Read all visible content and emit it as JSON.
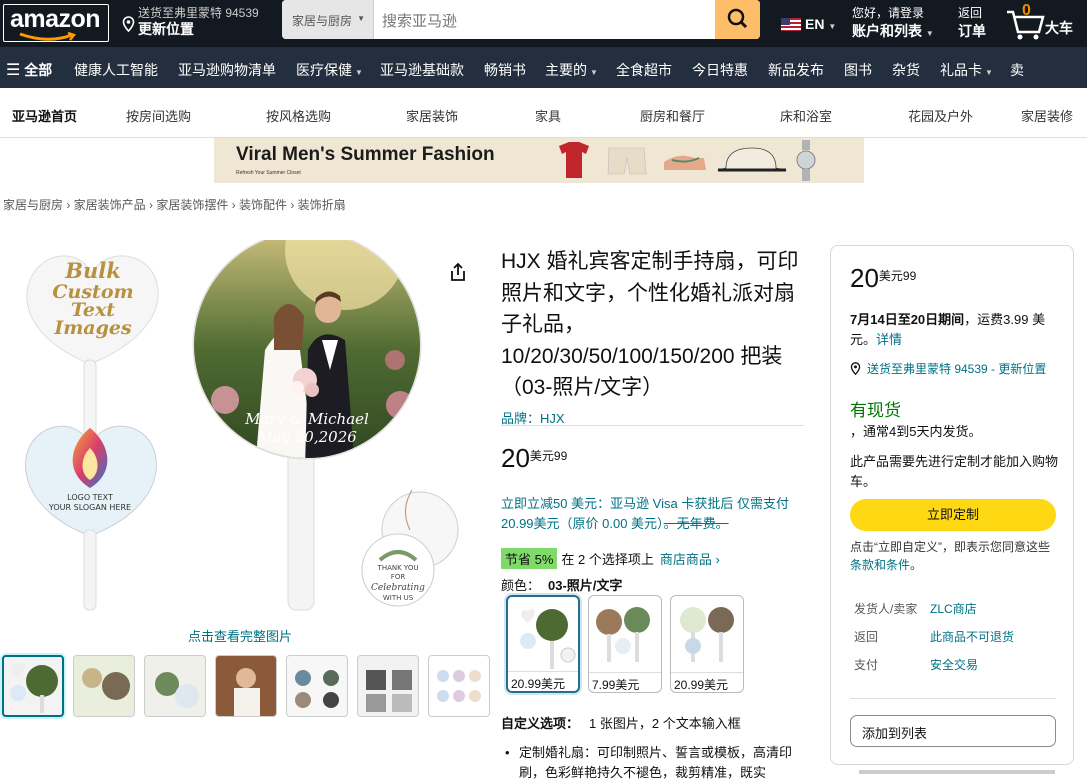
{
  "header": {
    "logo_text": "amazon",
    "deliver_line1": "送货至弗里蒙特 94539",
    "deliver_line2": "更新位置",
    "search_category": "家居与厨房",
    "search_placeholder": "搜索亚马逊",
    "language": "EN",
    "account_line1": "您好，请登录",
    "account_line2": "账户和列表",
    "orders_line1": "返回",
    "orders_line2": "订单",
    "cart_count": "0",
    "cart_label": "大车"
  },
  "nav": {
    "all": "全部",
    "items": [
      "健康人工智能",
      "亚马逊购物清单",
      "医疗保健",
      "亚马逊基础款",
      "畅销书",
      "主要的",
      "全食超市",
      "今日特惠",
      "新品发布",
      "图书",
      "杂货",
      "礼品卡",
      "卖"
    ]
  },
  "subnav": {
    "home": "亚马逊首页",
    "items": [
      "按房间选购",
      "按风格选购",
      "家居装饰",
      "家具",
      "厨房和餐厅",
      "床和浴室",
      "花园及户外",
      "家居装修"
    ]
  },
  "banner": {
    "title": "Viral Men's Summer Fashion",
    "subtitle": "Refresh Your Summer Closet"
  },
  "breadcrumb": "家居与厨房 › 家居装饰产品 › 家居装饰摆件 › 装饰配件 › 装饰折扇",
  "gallery": {
    "fan_text_1": "Bulk Custom Text Images",
    "fan_logo_text": "LOGO TEXT",
    "fan_slogan": "YOUR SLOGAN HERE",
    "names": "Mary & Michael",
    "date": "May 20,2026",
    "tag_text": "THANK YOU FOR Celebrating WITH US",
    "see_full": "点击查看完整图片"
  },
  "product": {
    "title": "HJX 婚礼宾客定制手持扇，可印照片和文字，个性化婚礼派对扇子礼品，10/20/30/50/100/150/200 把装（03-照片/文字）",
    "brand": "品牌：HJX",
    "price_whole": "20",
    "price_sup": "美元99",
    "promo": "立即立减50 美元：亚马逊 Visa 卡获批后 仅需支付 20.99美元（原价 0.00 美元）",
    "promo_strike": "。无年费。",
    "save_badge": "节省 5%",
    "save_text": "在 2 个选择项上",
    "save_link": "商店商品 ›",
    "color_label": "颜色：",
    "color_value": "03-照片/文字",
    "swatches": [
      {
        "price": "20.99美元"
      },
      {
        "price": "7.99美元"
      },
      {
        "price": "20.99美元"
      }
    ],
    "custom_label": "自定义选项：",
    "custom_value": "1 张图片，2 个文本输入框",
    "bullet_1": "定制婚礼扇：可印制照片、誓言或模板，高清印刷，色彩鲜艳持久不褪色，裁剪精准，既实"
  },
  "buybox": {
    "price_whole": "20",
    "price_sup": "美元99",
    "ship_date": "7月14日至20日期间",
    "ship_fee": "，运费3.99 美元。",
    "details_link": "详情",
    "location": "送货至弗里蒙特 94539 - 更新位置",
    "stock": "有现货",
    "ships": "，通常4到5天内发货。",
    "note": "此产品需要先进行定制才能加入购物车。",
    "customize_button": "立即定制",
    "agree_text": "点击“立即自定义”，即表示您同意这些",
    "agree_link": "条款和条件",
    "agree_end": "。",
    "seller_label": "发货人/卖家",
    "seller_value": "ZLC商店",
    "return_label": "返回",
    "return_value": "此商品不可退货",
    "payment_label": "支付",
    "payment_value": "安全交易",
    "add_list_button": "添加到列表"
  },
  "colors": {
    "top_bar": "#131921",
    "nav_bar": "#232f3e",
    "link": "#007185",
    "accent": "#febd69",
    "button": "#ffd814",
    "in_stock": "#007600"
  }
}
